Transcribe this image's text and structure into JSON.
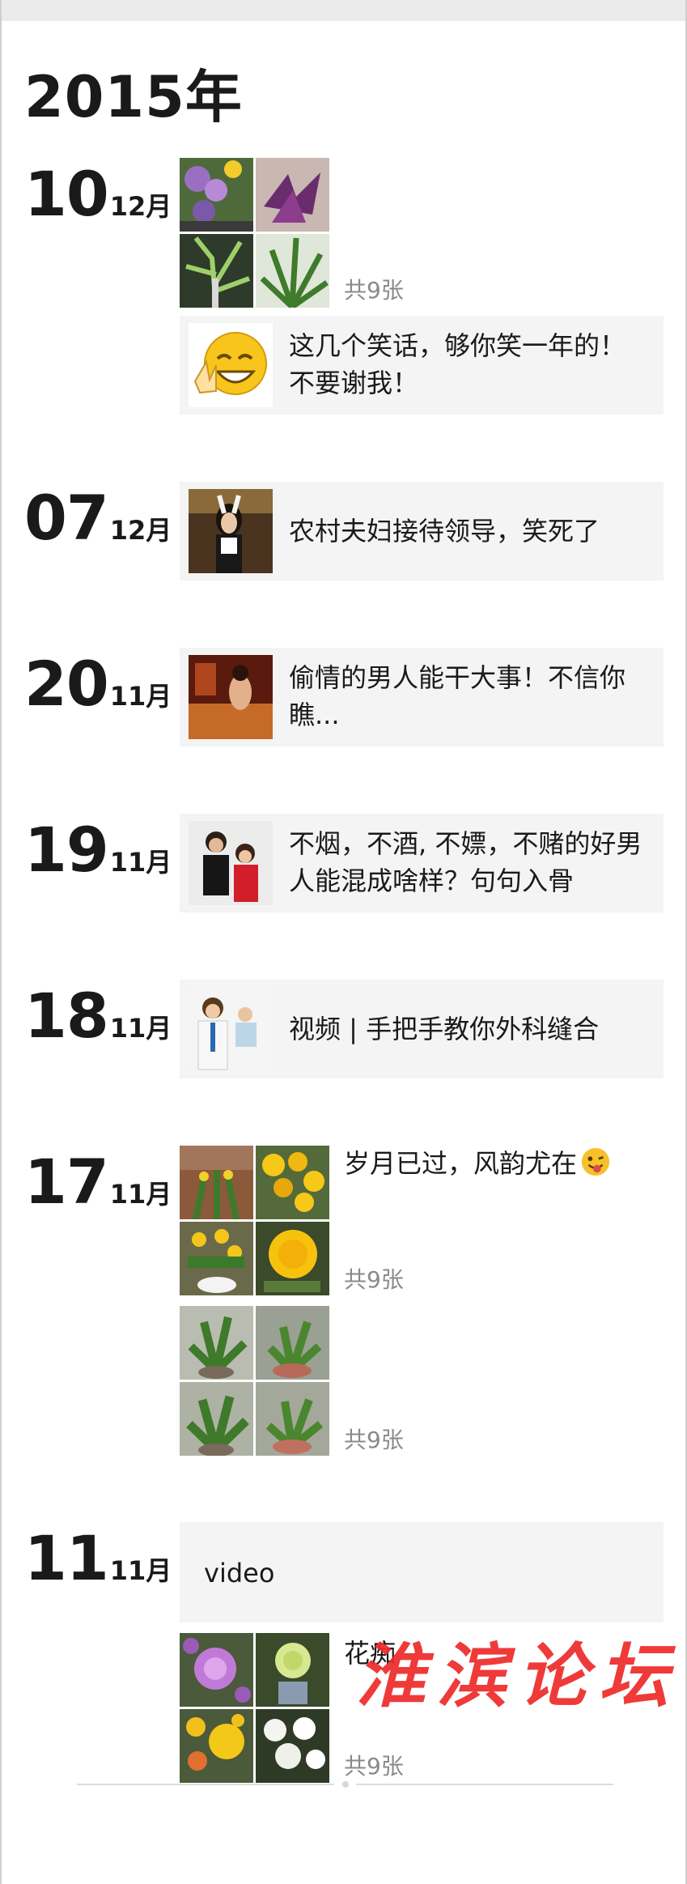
{
  "year_label": "2015年",
  "entries": [
    {
      "day": "10",
      "month": "12月",
      "count": "共9张",
      "card_text": "这几个笑话，够你笑一年的！不要谢我！"
    },
    {
      "day": "07",
      "month": "12月",
      "card_text": "农村夫妇接待领导，笑死了"
    },
    {
      "day": "20",
      "month": "11月",
      "card_text": "偷情的男人能干大事！不信你瞧..."
    },
    {
      "day": "19",
      "month": "11月",
      "card_text": "不烟，不酒, 不嫖，不赌的好男人能混成啥样？句句入骨"
    },
    {
      "day": "18",
      "month": "11月",
      "card_text": "视频 | 手把手教你外科缝合"
    },
    {
      "day": "17",
      "month": "11月",
      "post_text": "岁月已过，风韵尤在",
      "count_a": "共9张",
      "count_b": "共9张"
    },
    {
      "day": "11",
      "month": "11月",
      "video_text": "video",
      "post_text": "花痴",
      "count": "共9张"
    }
  ],
  "watermark": "淮滨论坛",
  "icons": {
    "smiley": "smiley-face-icon",
    "wink": "winking-tongue-emoji-icon"
  },
  "colors": {
    "card_bg": "#f4f4f4",
    "count_text": "#8a8a8a",
    "watermark": "#ee2a2a"
  }
}
